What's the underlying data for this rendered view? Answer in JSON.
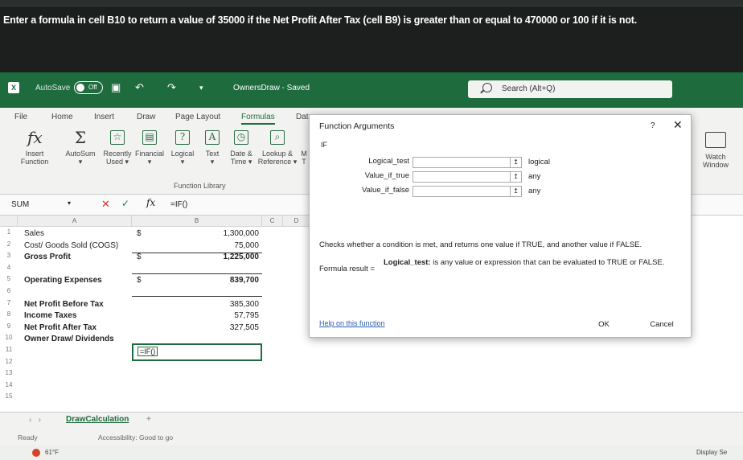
{
  "instruction": "Enter a formula in cell B10 to return a value of 35000 if the Net Profit After Tax (cell B9) is greater than or equal to 470000 or 100 if it is not.",
  "titlebar": {
    "autosave_label": "AutoSave",
    "autosave_state": "Off",
    "doc_title": "OwnersDraw - Saved",
    "search_placeholder": "Search (Alt+Q)"
  },
  "ribbon": {
    "tabs": [
      "File",
      "Home",
      "Insert",
      "Draw",
      "Page Layout",
      "Formulas",
      "Data"
    ],
    "active_tab": "Formulas",
    "buttons": [
      {
        "label": "Insert\nFunction",
        "icon": "fx-icon"
      },
      {
        "label": "AutoSum",
        "icon": "sigma-icon"
      },
      {
        "label": "Recently\nUsed",
        "icon": "star-icon"
      },
      {
        "label": "Financial",
        "icon": "book-icon"
      },
      {
        "label": "Logical",
        "icon": "question-icon"
      },
      {
        "label": "Text",
        "icon": "text-icon"
      },
      {
        "label": "Date &\nTime",
        "icon": "clock-icon"
      },
      {
        "label": "Lookup &\nReference",
        "icon": "search-icon"
      },
      {
        "label": "M",
        "icon": "math-icon"
      }
    ],
    "group_label": "Function Library",
    "watch_label": "Watch\nWindow"
  },
  "formula_bar": {
    "name_box": "SUM",
    "formula": "=IF()"
  },
  "grid": {
    "columns": [
      "A",
      "B",
      "C",
      "D"
    ],
    "rows": [
      {
        "n": "1",
        "label": "Sales",
        "sym": "$",
        "value": "1,300,000"
      },
      {
        "n": "2",
        "label": "Cost/ Goods Sold (COGS)",
        "sym": "",
        "value": "75,000"
      },
      {
        "n": "3",
        "label": "Gross Profit",
        "sym": "$",
        "value": "1,225,000"
      },
      {
        "n": "4",
        "label": "",
        "sym": "",
        "value": ""
      },
      {
        "n": "5",
        "label": "Operating Expenses",
        "sym": "$",
        "value": "839,700"
      },
      {
        "n": "6",
        "label": "",
        "sym": "",
        "value": ""
      },
      {
        "n": "7",
        "label": "Net Profit Before Tax",
        "sym": "",
        "value": "385,300"
      },
      {
        "n": "8",
        "label": "Income Taxes",
        "sym": "",
        "value": "57,795"
      },
      {
        "n": "9",
        "label": "Net Profit After Tax",
        "sym": "",
        "value": "327,505"
      },
      {
        "n": "10",
        "label": "Owner Draw/ Dividends",
        "sym": "",
        "value": ""
      },
      {
        "n": "11",
        "label": "",
        "sym": "",
        "value": ""
      },
      {
        "n": "12",
        "label": "",
        "sym": "",
        "value": ""
      },
      {
        "n": "13",
        "label": "",
        "sym": "",
        "value": ""
      },
      {
        "n": "14",
        "label": "",
        "sym": "",
        "value": ""
      },
      {
        "n": "15",
        "label": "",
        "sym": "",
        "value": ""
      }
    ],
    "active_cell_value": "=IF()"
  },
  "sheet_tab": "DrawCalculation",
  "status": {
    "ready": "Ready",
    "accessibility": "Accessibility: Good to go",
    "temperature": "61°F",
    "display": "Display Se"
  },
  "dialog": {
    "title": "Function Arguments",
    "help": "?",
    "function_name": "IF",
    "args": [
      {
        "label": "Logical_test",
        "type": "logical"
      },
      {
        "label": "Value_if_true",
        "type": "any"
      },
      {
        "label": "Value_if_false",
        "type": "any"
      }
    ],
    "description": "Checks whether a condition is met, and returns one value if TRUE, and another value if FALSE.",
    "arg_help_name": "Logical_test:",
    "arg_help_text": "is any value or expression that can be evaluated to TRUE or FALSE.",
    "result_label": "Formula result =",
    "help_link": "Help on this function",
    "ok_label": "OK",
    "cancel_label": "Cancel"
  }
}
